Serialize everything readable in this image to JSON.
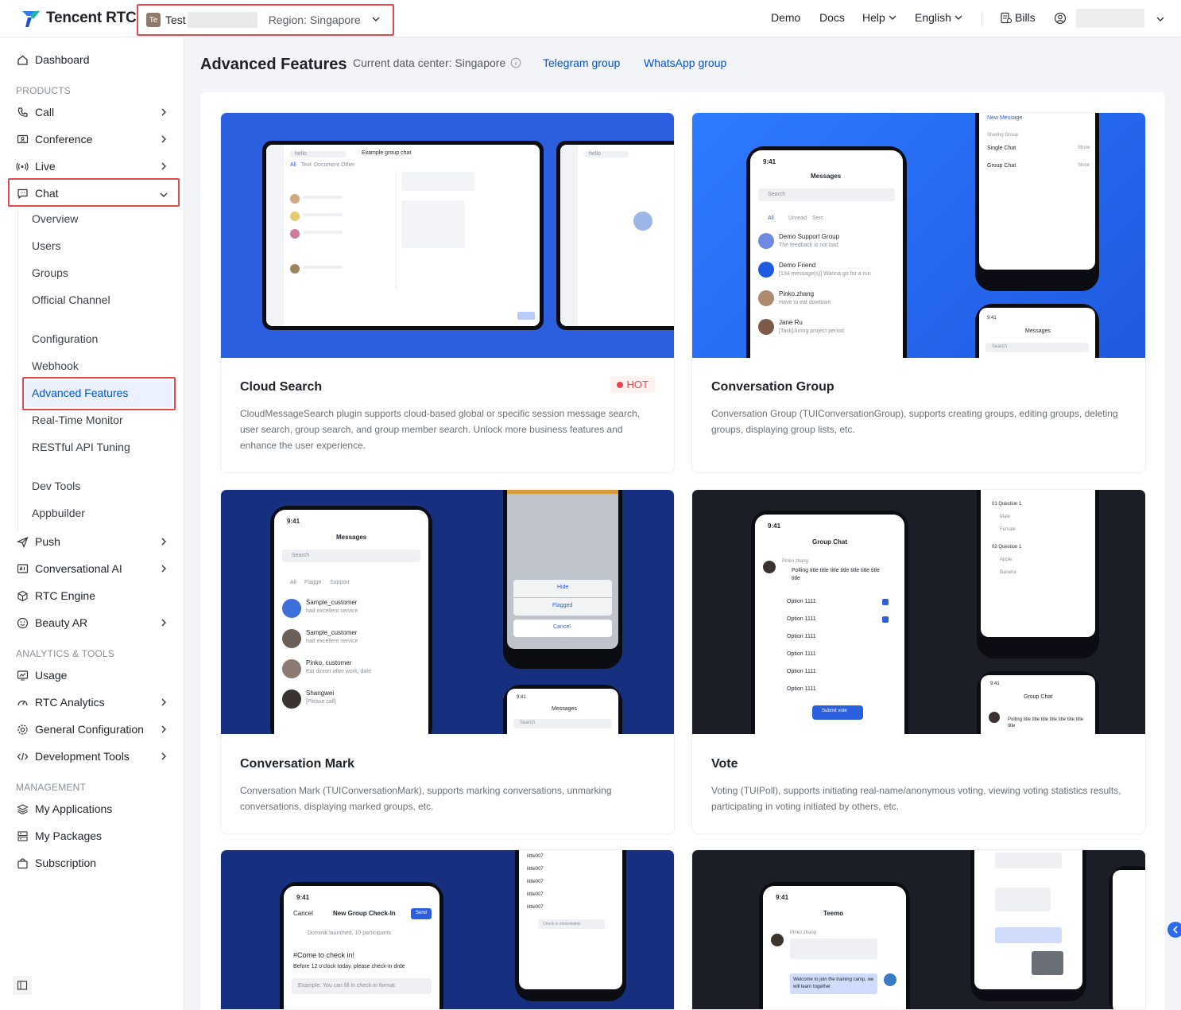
{
  "topbar": {
    "logo_text": "Tencent RTC",
    "app_badge": "Te",
    "app_name": "Test",
    "region": "Region: Singapore",
    "nav": {
      "demo": "Demo",
      "docs": "Docs",
      "help": "Help",
      "language": "English",
      "bills": "Bills"
    }
  },
  "sidebar": {
    "dashboard": "Dashboard",
    "section_products": "PRODUCTS",
    "call": "Call",
    "conference": "Conference",
    "live": "Live",
    "chat": "Chat",
    "chat_sub": [
      "Overview",
      "Users",
      "Groups",
      "Official Channel",
      "Configuration",
      "Webhook",
      "Advanced Features",
      "Real-Time Monitor",
      "RESTful API Tuning",
      "Dev Tools",
      "Appbuilder"
    ],
    "push": "Push",
    "conversational_ai": "Conversational AI",
    "rtc_engine": "RTC Engine",
    "beauty_ar": "Beauty AR",
    "section_analytics": "ANALYTICS & TOOLS",
    "usage": "Usage",
    "rtc_analytics": "RTC Analytics",
    "general_config": "General Configuration",
    "dev_tools": "Development Tools",
    "section_management": "MANAGEMENT",
    "my_applications": "My Applications",
    "my_packages": "My Packages",
    "subscription": "Subscription"
  },
  "main": {
    "title": "Advanced Features",
    "datacenter": "Current data center: Singapore",
    "telegram": "Telegram group",
    "whatsapp": "WhatsApp group"
  },
  "cards": [
    {
      "title": "Cloud Search",
      "badge": "HOT",
      "desc": "CloudMessageSearch plugin supports cloud-based global or specific session message search, user search, group search, and group member search. Unlock more business features and enhance the user experience."
    },
    {
      "title": "Conversation Group",
      "desc": "Conversation Group (TUIConversationGroup), supports creating groups, editing groups, deleting groups, displaying group lists, etc."
    },
    {
      "title": "Conversation Mark",
      "desc": "Conversation Mark (TUIConversationMark), supports marking conversations, unmarking conversations, displaying marked groups, etc."
    },
    {
      "title": "Vote",
      "desc": "Voting (TUIPoll), supports initiating real-name/anonymous voting, viewing voting statistics results, participating in voting initiated by others, etc."
    }
  ],
  "mock": {
    "search": "Search",
    "messages": "Messages",
    "time": "9:41",
    "example_group": "Example group chat",
    "hello": "hello",
    "tabs_all": "All",
    "tabs_text": "Text",
    "tabs_document": "Document",
    "tabs_other": "Other",
    "new_message": "New Message",
    "sharing_group": "Sharing Group",
    "single_chat": "Single Chat",
    "group_chat": "Group Chat",
    "show": "Show",
    "unread": "Unread",
    "serc": "Serc",
    "flagge": "Flagge",
    "support": "Support",
    "conv_rows": [
      {
        "name": "Demo Support Group",
        "msg": "The feedback is not bad"
      },
      {
        "name": "Demo Friend",
        "msg": "[134 message(s)] Wanna go for a run"
      },
      {
        "name": "Pinko.zhang",
        "msg": "Have to eat dowtown"
      },
      {
        "name": "Jane Ru",
        "msg": "[Task]Juring project period"
      }
    ],
    "mark_rows": [
      {
        "name": "Sample_customer",
        "msg": "had excellent service"
      },
      {
        "name": "Sample_customer",
        "msg": "had excellent service"
      },
      {
        "name": "Pinko, customer",
        "msg": "Eat dinner after work, date"
      },
      {
        "name": "Shangwei",
        "msg": "[Please call]"
      }
    ],
    "hide": "Hide",
    "flagged": "Flagged",
    "cancel": "Cancel",
    "poll_title": "Polling title title title title title title title title",
    "poll_option": "Option 1111",
    "submit_vote": "Submit vote",
    "question1": "01 Question 1",
    "question2": "02 Question 1",
    "male": "Male",
    "female": "Female",
    "apple": "Apple",
    "banana": "Banana",
    "new_group_checkin": "New Group Check-In",
    "send": "Send",
    "checkin_text": "#Come to check in!",
    "checkin_sub": "Before 12 o'clock today, please check-in drde",
    "checkin_example": "Example: You can fill in check-in format",
    "participants": "Dominik launched, 10 participants",
    "little": "little007",
    "check_immediately": "Check in immediately",
    "teemo": "Teemo",
    "pinko_zhang": "Pinko zhang",
    "welcome": "Welcome to join the training camp, we will learn together"
  },
  "colors": {
    "accent": "#0052d9",
    "highlight": "#e5484d",
    "card_blue": "#2b5fe0",
    "card_navy": "#16307f",
    "card_dark": "#1b1e27"
  }
}
